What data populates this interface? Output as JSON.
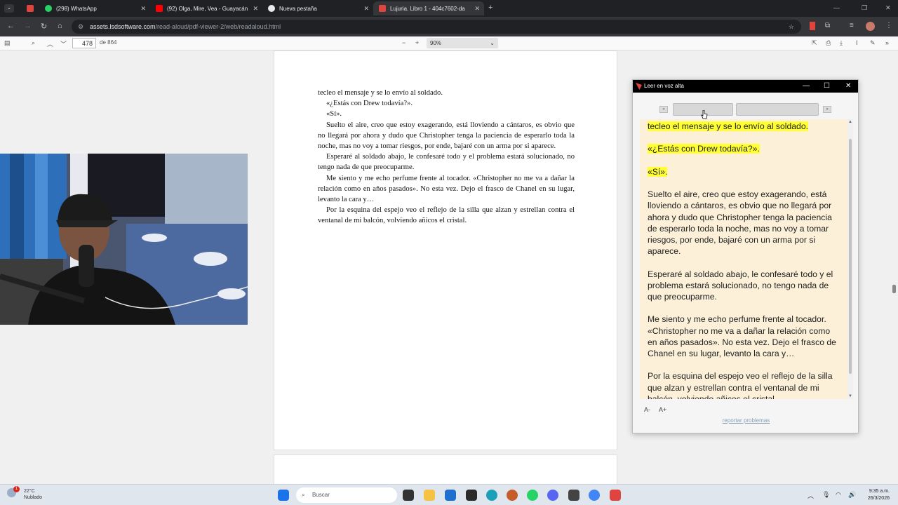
{
  "browser": {
    "tabs": [
      {
        "label": "(298) WhatsApp",
        "active": false
      },
      {
        "label": "(92) Olga, Mire, Vea - Guayacán",
        "active": false
      },
      {
        "label": "Nueva pestaña",
        "active": false
      },
      {
        "label": "Lujuria. Libro 1 - 404c7602-da",
        "active": true
      }
    ],
    "url_host": "assets.lsdsoftware.com",
    "url_path": "/read-aloud/pdf-viewer-2/web/readaloud.html"
  },
  "pdf_toolbar": {
    "page_number": "478",
    "page_total": "de 864",
    "zoom": "90%"
  },
  "pdf_page": {
    "paragraphs": [
      "tecleo el mensaje y se lo envío al soldado.",
      "«¿Estás con Drew todavía?».",
      "«Sí».",
      "Suelto el aire, creo que estoy exagerando, está lloviendo a cántaros, es obvio que no llegará por ahora y dudo que Christopher tenga la paciencia de esperarlo toda la noche, mas no voy a tomar riesgos, por ende, bajaré con un arma por si aparece.",
      "Esperaré al soldado abajo, le confesaré todo y el problema estará solucionado, no tengo nada de que preocuparme.",
      "Me siento y me echo perfume frente al tocador. «Christopher no me va a dañar la relación como en años pasados». No esta vez. Dejo el frasco de Chanel en su lugar, levanto la cara y…",
      "Por la esquina del espejo veo el reflejo de la silla que alzan y estrellan contra el ventanal de mi balcón, volviendo añicos el cristal."
    ]
  },
  "read_aloud": {
    "title": "Leer en voz alta",
    "paragraphs": [
      "tecleo el mensaje y se lo envío al soldado.",
      "«¿Estás con Drew todavía?».",
      "«Sí».",
      "Suelto el aire, creo que estoy exagerando, está lloviendo a cántaros, es obvio que no llegará por ahora y dudo que Christopher tenga la paciencia de esperarlo toda la noche, mas no voy a tomar riesgos, por ende, bajaré con un arma por si aparece.",
      "Esperaré al soldado abajo, le confesaré todo y el problema estará solucionado, no tengo nada de que preocuparme.",
      "Me siento y me echo perfume frente al tocador. «Christopher no me va a dañar la relación como en años pasados». No esta vez. Dejo el frasco de Chanel en su lugar, levanto la cara y…",
      "Por la esquina del espejo veo el reflejo de la silla que alzan y estrellan contra el ventanal de mi balcón, volviendo añicos el cristal."
    ],
    "highlighted_count": 3,
    "font_decrease": "A-",
    "font_increase": "A+",
    "report_link": "reportar problemas",
    "highlight_color": "#ffff33",
    "background_color": "#fdf0d9"
  },
  "taskbar": {
    "temperature": "22°C",
    "weather": "Nublado",
    "weather_badge": "1",
    "search_placeholder": "Buscar",
    "time": "9:35 a.m.",
    "date": "26/3/2026"
  }
}
